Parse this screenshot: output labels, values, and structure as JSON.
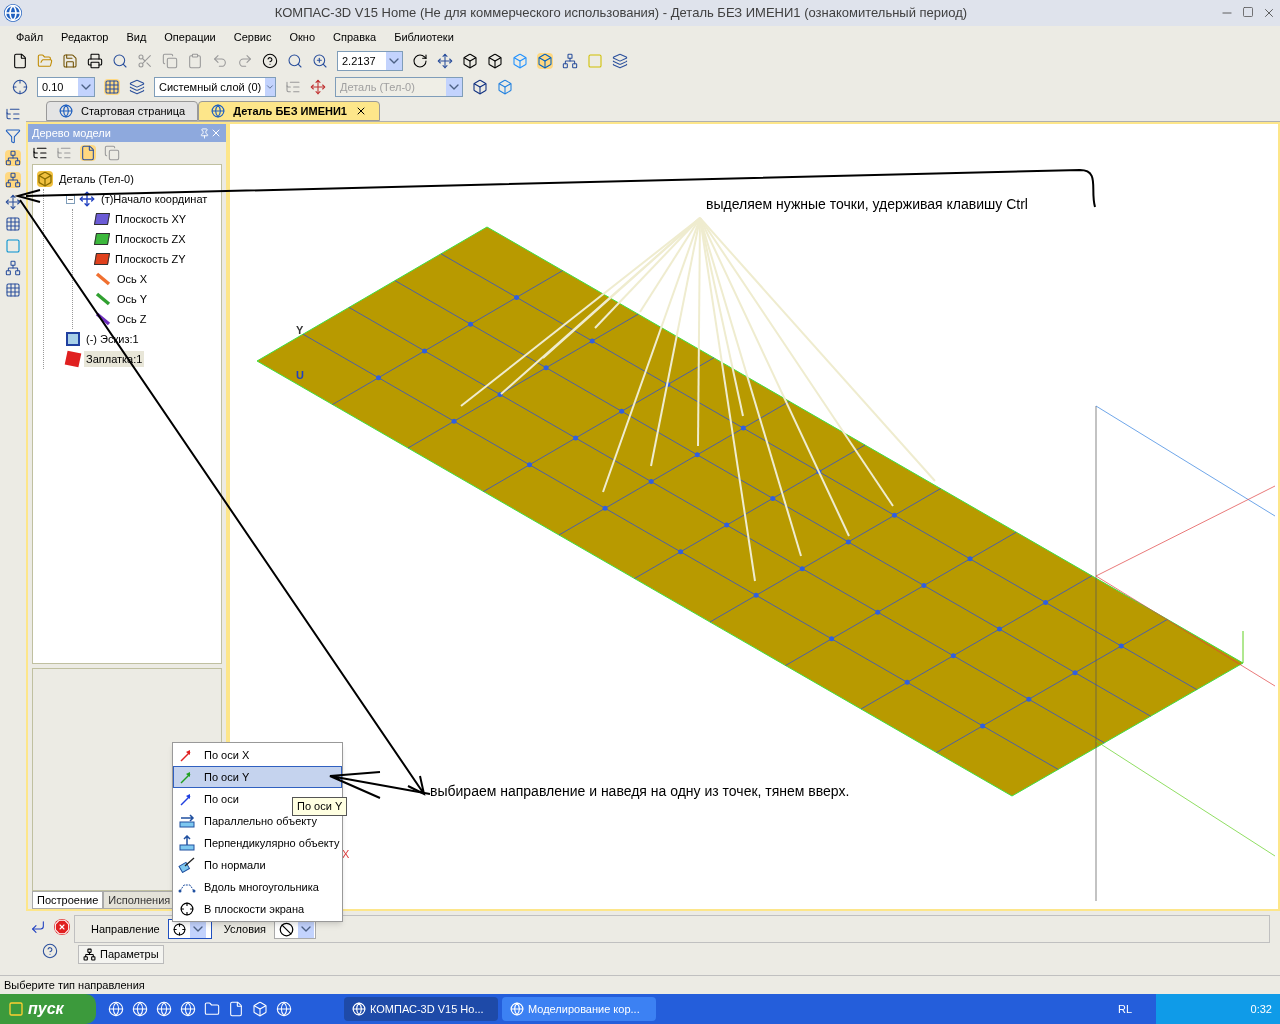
{
  "window": {
    "title": "КОМПАС-3D V15 Home (Не для коммерческого использования) - Деталь БЕЗ ИМЕНИ1 (ознакомительный период)"
  },
  "menu": [
    "Файл",
    "Редактор",
    "Вид",
    "Операции",
    "Сервис",
    "Окно",
    "Справка",
    "Библиотеки"
  ],
  "toolbar": {
    "zoom_value": "2.2137",
    "step_value": "0.10",
    "layer": "Системный слой (0)",
    "body": {
      "value": "Деталь (Тел-0)",
      "disabled": true
    }
  },
  "tabs": [
    {
      "label": "Стартовая страница",
      "selected": false
    },
    {
      "label": "Деталь БЕЗ ИМЕНИ1",
      "selected": true
    }
  ],
  "tree_panel": {
    "title": "Дерево модели",
    "items": [
      {
        "label": "Деталь (Тел-0)",
        "kind": "part",
        "children": [
          {
            "label": "(т)Начало координат",
            "kind": "origin",
            "expanded": true,
            "children": [
              {
                "label": "Плоскость XY",
                "kind": "plane",
                "color": "#6b5bd6"
              },
              {
                "label": "Плоскость ZX",
                "kind": "plane",
                "color": "#3cb83c"
              },
              {
                "label": "Плоскость ZY",
                "kind": "plane",
                "color": "#e0401c"
              },
              {
                "label": "Ось X",
                "kind": "axis",
                "color": "#f07030"
              },
              {
                "label": "Ось Y",
                "kind": "axis",
                "color": "#30a030"
              },
              {
                "label": "Ось Z",
                "kind": "axis",
                "color": "#7030c0"
              }
            ]
          },
          {
            "label": "(-) Эскиз:1",
            "kind": "sketch"
          },
          {
            "label": "Заплатка:1",
            "kind": "patch",
            "selected": true
          }
        ]
      }
    ],
    "tabs": [
      {
        "label": "Построение",
        "selected": true
      },
      {
        "label": "Исполнения",
        "selected": false
      }
    ]
  },
  "viewport": {
    "axis_labels": [
      "Y",
      "U",
      "X"
    ],
    "annotations": [
      "выделяем нужные точки, удерживая клавишу Ctrl",
      "выбираем направление и наведя на одну из точек, тянем вверх."
    ]
  },
  "direction_menu": {
    "items": [
      {
        "label": "По оси X",
        "kind": "axis-x",
        "selected": false
      },
      {
        "label": "По оси Y",
        "kind": "axis-y",
        "selected": true
      },
      {
        "label": "По оси",
        "kind": "axis-z",
        "selected": false
      },
      {
        "label": "Параллельно объекту",
        "kind": "parallel",
        "selected": false
      },
      {
        "label": "Перпендикулярно объекту",
        "kind": "perpendicular",
        "selected": false
      },
      {
        "label": "По нормали",
        "kind": "normal",
        "selected": false
      },
      {
        "label": "Вдоль многоугольника",
        "kind": "polygon",
        "selected": false
      },
      {
        "label": "В плоскости экрана",
        "kind": "screen",
        "selected": false
      }
    ],
    "tooltip": "По оси Y"
  },
  "property_bar": {
    "direction_label": "Направление",
    "conditions_label": "Условия",
    "tab": "Параметры"
  },
  "status_bar": "Выберите тип направления",
  "taskbar": {
    "start": "пуск",
    "tasks": [
      {
        "label": "КОМПАС-3D V15 Ho...",
        "selected": true
      },
      {
        "label": "Моделирование кор...",
        "selected": false
      }
    ],
    "language": "RL",
    "clock": "0:32"
  }
}
